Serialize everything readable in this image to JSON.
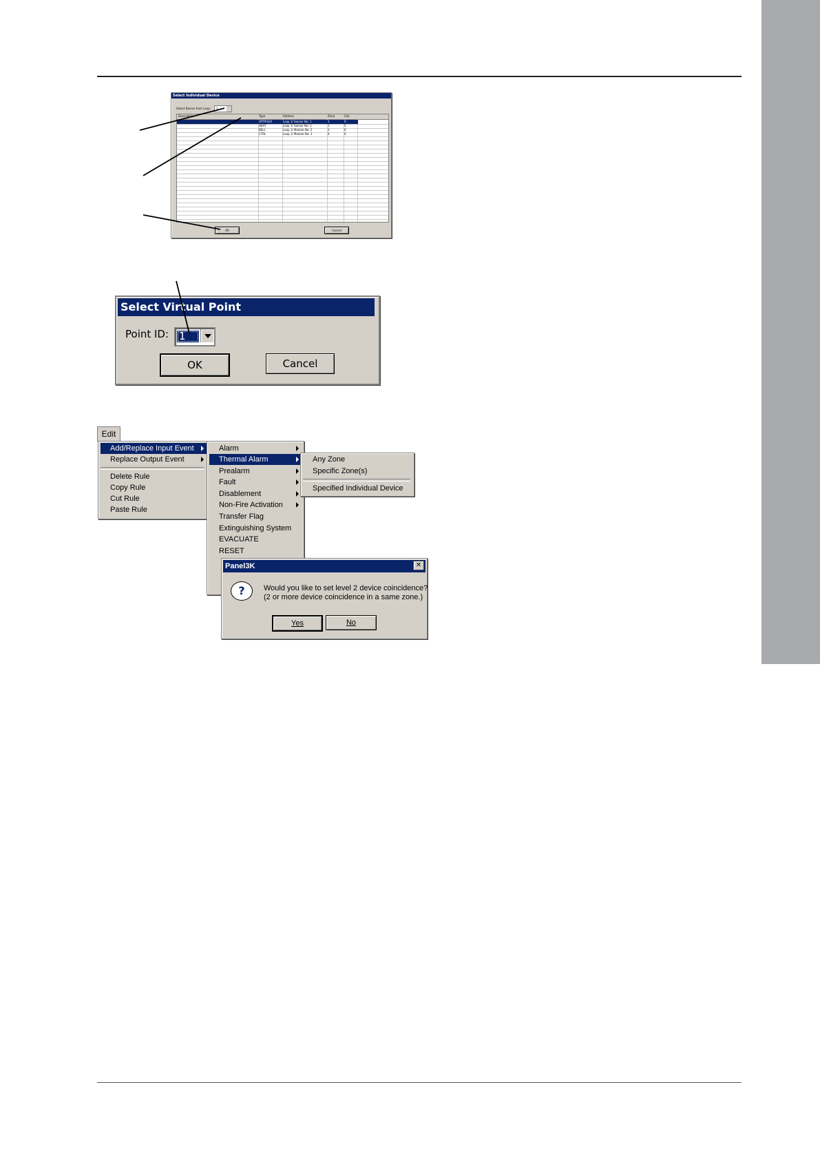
{
  "device_dialog": {
    "title": "Select Individual Device",
    "loop_label": "Select Device from Loop:",
    "loop_value": "1",
    "columns": [
      "Description",
      "Type",
      "Address",
      "Zone",
      "Coll."
    ],
    "rows": [
      {
        "description": "",
        "type": "OPTIPLEX",
        "address": "Loop 1/ Sensor No: 1",
        "zone": "1",
        "coll": "0",
        "selected": true
      },
      {
        "description": "",
        "type": "HEAT",
        "address": "Loop 1/ Sensor No: 2",
        "zone": "1",
        "coll": "5",
        "selected": false
      },
      {
        "description": "",
        "type": "BELL",
        "address": "Loop 1/ Module No: 2",
        "zone": "3",
        "coll": "0",
        "selected": false
      },
      {
        "description": "",
        "type": "CTRL",
        "address": "Loop 1/ Module No: 3",
        "zone": "4",
        "coll": "0",
        "selected": false
      }
    ],
    "ok_label": "OK",
    "cancel_label": "Cancel"
  },
  "virtual_point_dialog": {
    "title": "Select Virtual Point",
    "point_label": "Point ID:",
    "point_value": "1",
    "ok_label": "OK",
    "cancel_label": "Cancel"
  },
  "menu": {
    "menubar_label": "Edit",
    "edit_items": [
      {
        "label": "Add/Replace Input Event",
        "submenu": true,
        "highlighted": true
      },
      {
        "label": "Replace Output Event",
        "submenu": true,
        "highlighted": false
      },
      {
        "label": "Delete Rule",
        "submenu": false,
        "highlighted": false
      },
      {
        "label": "Copy Rule",
        "submenu": false,
        "highlighted": false
      },
      {
        "label": "Cut Rule",
        "submenu": false,
        "highlighted": false
      },
      {
        "label": "Paste Rule",
        "submenu": false,
        "highlighted": false
      }
    ],
    "input_event_items": [
      {
        "label": "Alarm",
        "submenu": true,
        "highlighted": false
      },
      {
        "label": "Thermal Alarm",
        "submenu": true,
        "highlighted": true
      },
      {
        "label": "Prealarm",
        "submenu": true,
        "highlighted": false
      },
      {
        "label": "Fault",
        "submenu": true,
        "highlighted": false
      },
      {
        "label": "Disablement",
        "submenu": true,
        "highlighted": false
      },
      {
        "label": "Non-Fire Activation",
        "submenu": true,
        "highlighted": false
      },
      {
        "label": "Transfer Flag",
        "submenu": false,
        "highlighted": false
      },
      {
        "label": "Extinguishing System",
        "submenu": false,
        "highlighted": false
      },
      {
        "label": "EVACUATE",
        "submenu": false,
        "highlighted": false
      },
      {
        "label": "RESET",
        "submenu": false,
        "highlighted": false
      }
    ],
    "thermal_items": [
      {
        "label": "Any Zone"
      },
      {
        "label": "Specific Zone(s)"
      },
      {
        "label": "Specified Individual Device"
      }
    ]
  },
  "panel3k_dialog": {
    "title": "Panel3K",
    "close_glyph": "✕",
    "icon_glyph": "?",
    "message_line1": "Would you like to set level 2 device coincidence?",
    "message_line2": "(2 or more device coincidence in a same zone.)",
    "yes_label": "Yes",
    "no_label": "No"
  }
}
